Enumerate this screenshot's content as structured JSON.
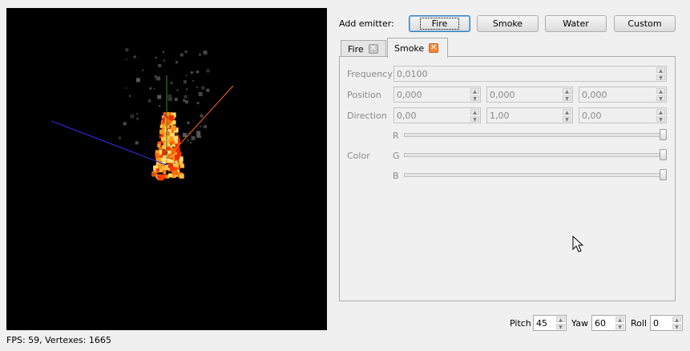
{
  "viewport": {
    "background": "#000000",
    "axis_colors": {
      "x": "#ff6a1a",
      "y": "#3a8a3a",
      "z": "#2a2ad0"
    }
  },
  "status": {
    "text": "FPS: 59, Vertexes: 1665"
  },
  "emitters": {
    "label": "Add emitter:",
    "buttons": [
      "Fire",
      "Smoke",
      "Water",
      "Custom"
    ],
    "focused": "Fire"
  },
  "tabs": [
    {
      "label": "Fire",
      "active": false
    },
    {
      "label": "Smoke",
      "active": true
    }
  ],
  "form": {
    "frequency": {
      "label": "Frequency",
      "value": "0,0100"
    },
    "position": {
      "label": "Position",
      "values": [
        "0,000",
        "0,000",
        "0,000"
      ]
    },
    "direction": {
      "label": "Direction",
      "values": [
        "0,00",
        "1,00",
        "0,00"
      ]
    },
    "color": {
      "label": "Color",
      "channels": [
        "R",
        "G",
        "B"
      ],
      "levels": [
        1.0,
        1.0,
        1.0
      ]
    }
  },
  "camera": {
    "pitch": {
      "label": "Pitch",
      "value": "45"
    },
    "yaw": {
      "label": "Yaw",
      "value": "60"
    },
    "roll": {
      "label": "Roll",
      "value": "0"
    }
  }
}
